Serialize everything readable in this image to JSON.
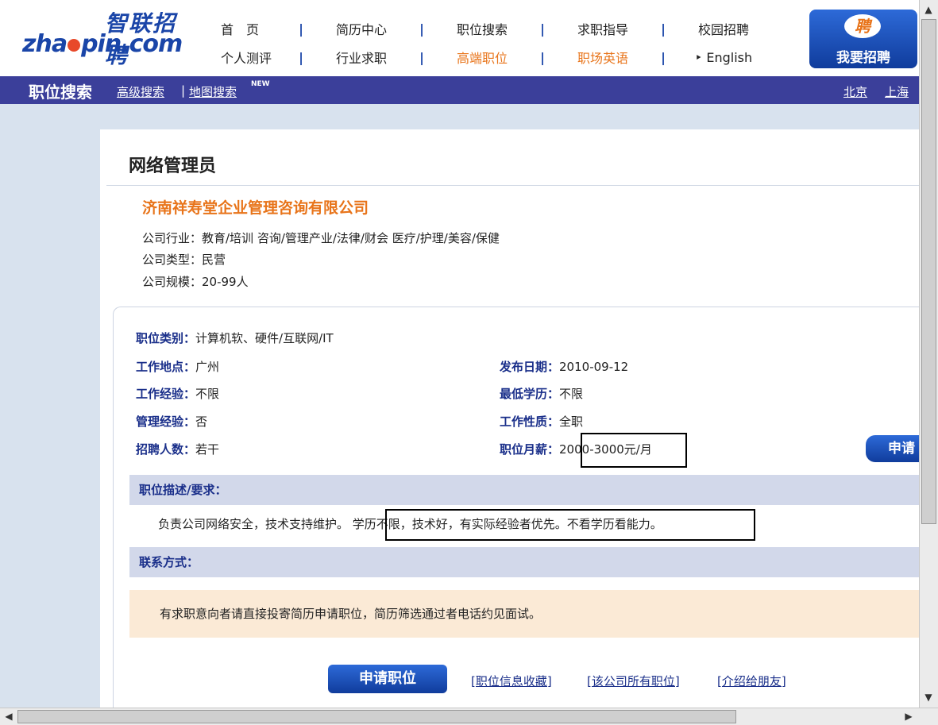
{
  "logo": {
    "cn": "智联招聘",
    "en_left": "zha",
    "en_right": "pin.com"
  },
  "nav": {
    "row1": [
      "首　页",
      "简历中心",
      "职位搜索",
      "求职指导",
      "校园招聘"
    ],
    "row2": [
      "个人测评",
      "行业求职",
      "高端职位",
      "职场英语",
      "‣ English"
    ],
    "separator": "|"
  },
  "recruit_button": {
    "icon_text": "聘",
    "label": "我要招聘"
  },
  "search_bar": {
    "title": "职位搜索",
    "advanced": "高级搜索",
    "map": "地图搜索",
    "new_badge": "NEW",
    "sep": "|",
    "cities": [
      "北京",
      "上海"
    ]
  },
  "job": {
    "title": "网络管理员",
    "company": "济南祥寿堂企业管理咨询有限公司",
    "industry": "公司行业：教育/培训 咨询/管理产业/法律/财会 医疗/护理/美容/保健",
    "type": "公司类型：民营",
    "size": "公司规模：20-99人",
    "category_label": "职位类别：",
    "category_value": "计算机软、硬件/互联网/IT",
    "location_label": "工作地点：",
    "location_value": "广州",
    "experience_label": "工作经验：",
    "experience_value": "不限",
    "management_label": "管理经验：",
    "management_value": "否",
    "headcount_label": "招聘人数：",
    "headcount_value": "若干",
    "date_label": "发布日期：",
    "date_value": "2010-09-12",
    "education_label": "最低学历：",
    "education_value": "不限",
    "nature_label": "工作性质：",
    "nature_value": "全职",
    "salary_label": "职位月薪：",
    "salary_value": "2000-3000元/月",
    "apply_small": "申请",
    "desc_header": "职位描述/要求：",
    "desc_text": "负责公司网络安全，技术支持维护。 学历不限，技术好，有实际经验者优先。不看学历看能力。",
    "contact_header": "联系方式：",
    "contact_text": "有求职意向者请直接投寄简历申请职位，简历筛选通过者电话约见面试。",
    "apply_big": "申请职位",
    "links": [
      "[职位信息收藏]",
      "[该公司所有职位]",
      "[介绍给朋友]"
    ]
  },
  "scroll": {
    "up": "▲",
    "down": "▼",
    "left": "◀",
    "right": "▶"
  }
}
